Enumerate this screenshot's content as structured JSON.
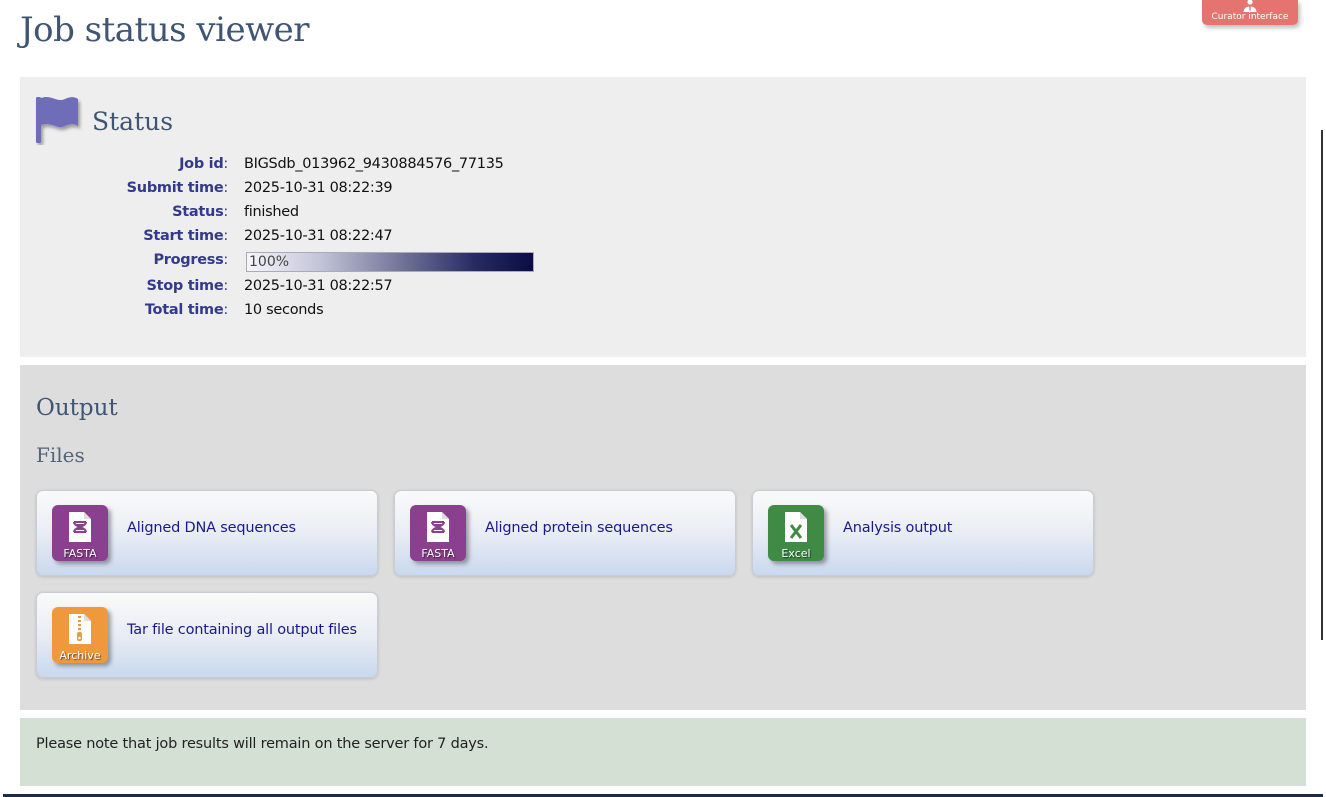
{
  "page": {
    "title": "Job status viewer"
  },
  "curator": {
    "label": "Curator interface"
  },
  "status": {
    "heading": "Status",
    "fields": {
      "job_id": {
        "label": "Job id",
        "value": "BIGSdb_013962_9430884576_77135"
      },
      "submit_time": {
        "label": "Submit time",
        "value": "2025-10-31 08:22:39"
      },
      "status": {
        "label": "Status",
        "value": "finished"
      },
      "start_time": {
        "label": "Start time",
        "value": "2025-10-31 08:22:47"
      },
      "progress": {
        "label": "Progress",
        "text": "100%",
        "percent": 100
      },
      "stop_time": {
        "label": "Stop time",
        "value": "2025-10-31 08:22:57"
      },
      "total_time": {
        "label": "Total time",
        "value": "10 seconds"
      }
    },
    "colon": ":"
  },
  "output": {
    "heading": "Output",
    "files_heading": "Files",
    "files": [
      {
        "icon": "dna-file-icon",
        "icon_label": "FASTA",
        "link": "Aligned DNA sequences",
        "color": "#8b3f8f"
      },
      {
        "icon": "dna-file-icon",
        "icon_label": "FASTA",
        "link": "Aligned protein sequences",
        "color": "#8b3f8f"
      },
      {
        "icon": "excel-file-icon",
        "icon_label": "Excel",
        "link": "Analysis output",
        "color": "#3f8a45"
      },
      {
        "icon": "archive-file-icon",
        "icon_label": "Archive",
        "link": "Tar file containing all output files",
        "color": "#f0993c"
      }
    ]
  },
  "note": {
    "text": "Please note that job results will remain on the server for 7 days."
  },
  "colors": {
    "heading": "#3f5573",
    "label": "#333a8c",
    "link": "#1a1a8c",
    "curator": "#e5736f",
    "flag": "#6f6db8"
  }
}
